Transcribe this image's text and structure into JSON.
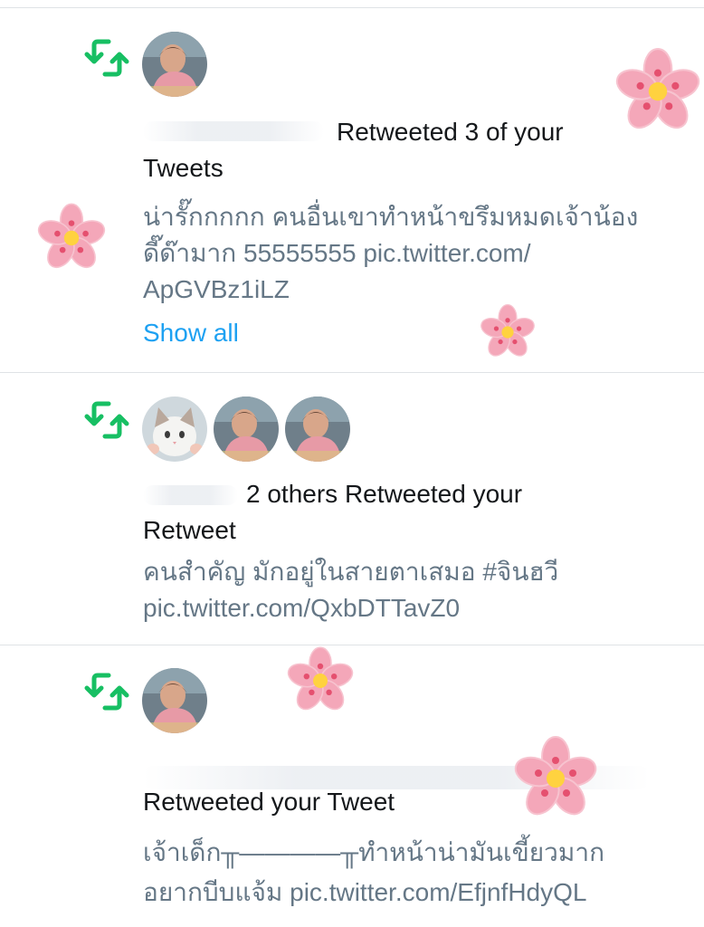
{
  "notifications": [
    {
      "icon": "retweet-icon",
      "avatars": [
        "user-avatar"
      ],
      "title_line1": "Retweeted 3 of your",
      "title_line2": "Tweets",
      "tweet_line1": "น่ารั๊กกกกก คนอื่นเขาทำหน้าขรึมหมดเจ้าน้อง",
      "tweet_line2": "ดี๊ด๊ามาก 55555555 pic.twitter.com/",
      "tweet_line3": "ApGVBz1iLZ",
      "show_all": "Show all"
    },
    {
      "icon": "retweet-icon",
      "avatars": [
        "cat-avatar",
        "user-avatar",
        "user-avatar"
      ],
      "title_line1": "2 others Retweeted your",
      "title_line2": "Retweet",
      "tweet_line1": "คนสำคัญ มักอยู่ในสายตาเสมอ #จินฮวี",
      "tweet_line2": "pic.twitter.com/QxbDTTavZ0"
    },
    {
      "icon": "retweet-icon",
      "avatars": [
        "user-avatar"
      ],
      "title_line1": "Retweeted your Tweet",
      "tweet_line1": "เจ้าเด็ก╥————╥ทำหน้าน่ามันเขี้ยวมาก",
      "tweet_line2": "อยากบีบแจ้ม pic.twitter.com/EfjnfHdyQL"
    }
  ],
  "colors": {
    "retweet_green": "#17bf63",
    "link_blue": "#1da1f2",
    "secondary_text": "#657786",
    "flower_pink": "#f4a7b9",
    "flower_center": "#ffd23f"
  }
}
